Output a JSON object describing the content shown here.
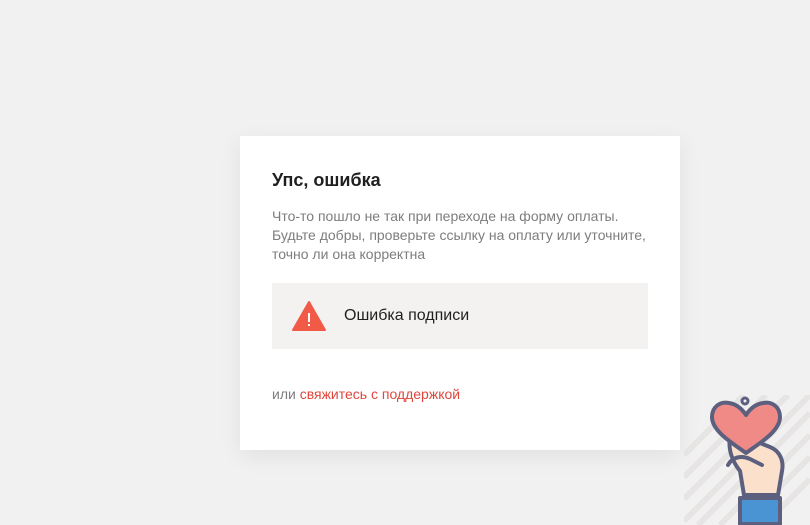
{
  "error_card": {
    "title": "Упс, ошибка",
    "description": "Что-то пошло не так при переходе на форму оплаты. Будьте добры, проверьте ссылку на оплату или уточните, точно ли она корректна",
    "alert": {
      "icon": "warning-triangle-icon",
      "text": "Ошибка подписи",
      "icon_color": "#f05a46"
    },
    "footer": {
      "prefix": "или",
      "link_text": "свяжитесь с поддержкой",
      "link_color": "#e1463b"
    }
  },
  "decoration": {
    "icon": "hand-holding-heart-icon"
  }
}
